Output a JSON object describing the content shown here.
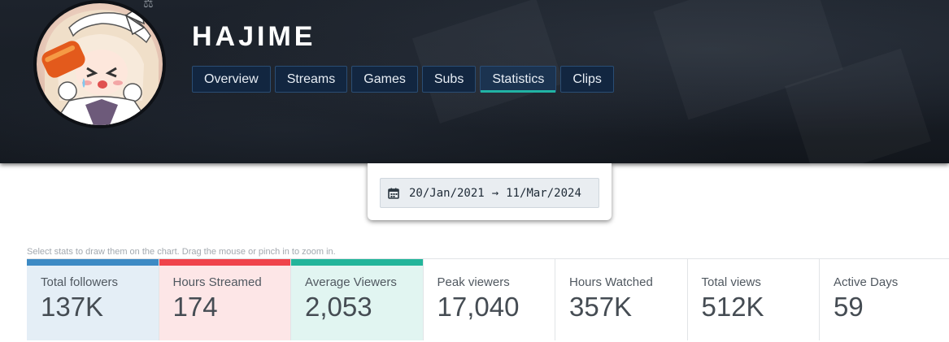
{
  "channel": {
    "name": "HAJIME"
  },
  "tabs": [
    {
      "label": "Overview",
      "active": false
    },
    {
      "label": "Streams",
      "active": false
    },
    {
      "label": "Games",
      "active": false
    },
    {
      "label": "Subs",
      "active": false
    },
    {
      "label": "Statistics",
      "active": true
    },
    {
      "label": "Clips",
      "active": false
    }
  ],
  "date_range": {
    "start": "20/Jan/2021",
    "arrow": "→",
    "end": "11/Mar/2024",
    "icon": "calendar-icon"
  },
  "hint": "Select stats to draw them on the chart. Drag the mouse or pinch in to zoom in.",
  "stats": [
    {
      "label": "Total followers",
      "value": "137K",
      "selected": true,
      "color": "#3d8ac4",
      "bg": "#e4eef6"
    },
    {
      "label": "Hours Streamed",
      "value": "174",
      "selected": true,
      "color": "#f0434b",
      "bg": "#fde6e7"
    },
    {
      "label": "Average Viewers",
      "value": "2,053",
      "selected": true,
      "color": "#22b59a",
      "bg": "#e1f5f1"
    },
    {
      "label": "Peak viewers",
      "value": "17,040",
      "selected": false
    },
    {
      "label": "Hours Watched",
      "value": "357K",
      "selected": false
    },
    {
      "label": "Total views",
      "value": "512K",
      "selected": false
    },
    {
      "label": "Active Days",
      "value": "59",
      "selected": false
    }
  ],
  "colors": {
    "banner": "#181d25",
    "tab_bg": "#122640",
    "tab_active_underline": "#21b3a4"
  }
}
